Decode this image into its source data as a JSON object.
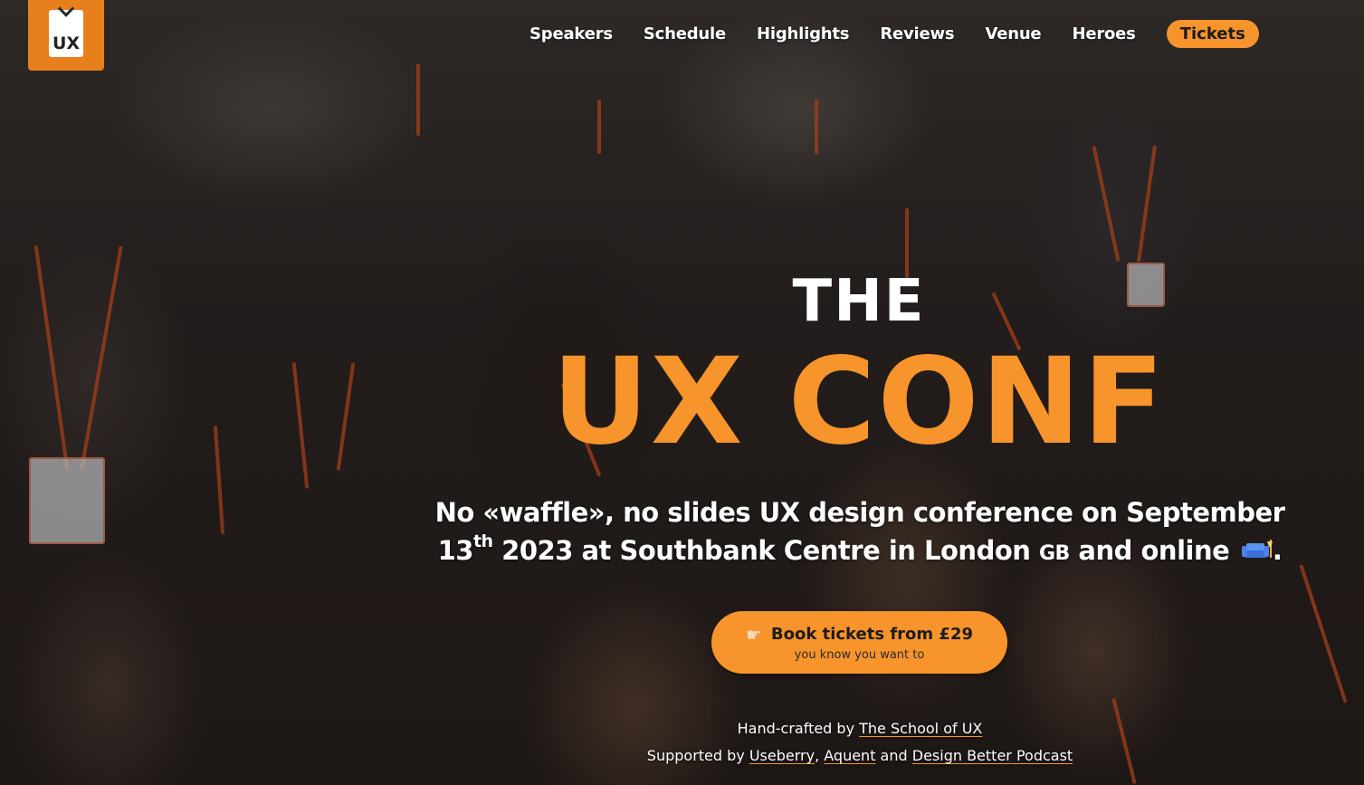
{
  "logo": {
    "text": "UX"
  },
  "nav": {
    "items": [
      {
        "label": "Speakers"
      },
      {
        "label": "Schedule"
      },
      {
        "label": "Highlights"
      },
      {
        "label": "Reviews"
      },
      {
        "label": "Venue"
      },
      {
        "label": "Heroes"
      }
    ],
    "tickets_label": "Tickets"
  },
  "hero": {
    "title_small": "THE",
    "title_large": "UX CONF",
    "tagline_part1": "No «waffle», no slides UX design conference on September 13",
    "tagline_sup": "th",
    "tagline_part2": " 2023 at Southbank Centre in London ",
    "tagline_flag": "GB",
    "tagline_part3": " and online ",
    "tagline_end": "."
  },
  "cta": {
    "label": "Book tickets from £29",
    "sublabel": "you know you want to",
    "icon": "pointing-hand-icon"
  },
  "credits": {
    "line1_prefix": "Hand-crafted by ",
    "line1_link": "The School of UX",
    "line2_prefix": "Supported by ",
    "sponsor1": "Useberry",
    "sep1": ", ",
    "sponsor2": "Aquent",
    "sep2": " and ",
    "sponsor3": "Design Better Podcast"
  },
  "colors": {
    "accent": "#f7942b",
    "logo_bg": "#e7801c",
    "text": "#ffffff"
  }
}
